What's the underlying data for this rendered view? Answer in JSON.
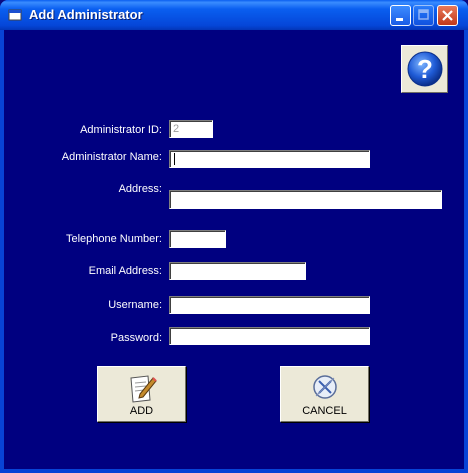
{
  "window": {
    "title": "Add Administrator",
    "buttons": [
      "minimize",
      "maximize",
      "close"
    ]
  },
  "help": {
    "icon": "question-mark-icon"
  },
  "form": {
    "fields": [
      {
        "label": "Administrator ID:",
        "value": "2",
        "enabled": false
      },
      {
        "label": "Administrator Name:",
        "value": ""
      },
      {
        "label": "Address:",
        "value": ""
      },
      {
        "label": "Telephone Number:",
        "value": ""
      },
      {
        "label": "Email Address:",
        "value": ""
      },
      {
        "label": "Username:",
        "value": ""
      },
      {
        "label": "Password:",
        "value": ""
      }
    ]
  },
  "actions": {
    "add_label": "ADD",
    "cancel_label": "CANCEL"
  },
  "colors": {
    "background": "#000080",
    "titlebar": "#0a5ff0",
    "button_face": "#ece9d8"
  }
}
